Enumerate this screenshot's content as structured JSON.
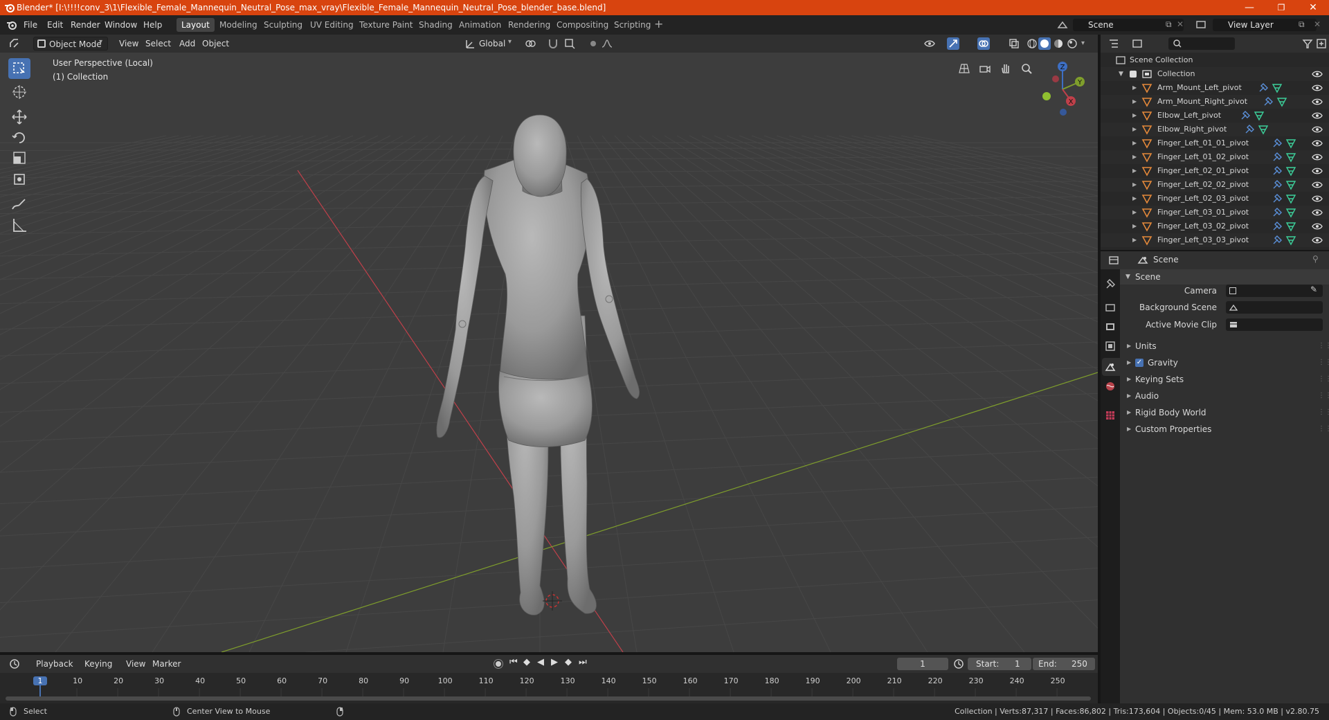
{
  "titlebar": {
    "title": "Blender* [I:\\!!!!conv_3\\1\\Flexible_Female_Mannequin_Neutral_Pose_max_vray\\Flexible_Female_Mannequin_Neutral_Pose_blender_base.blend]",
    "minimize": "—",
    "restore": "❐",
    "close": "✕"
  },
  "menus": [
    "File",
    "Edit",
    "Render",
    "Window",
    "Help"
  ],
  "workspaces": [
    "Layout",
    "Modeling",
    "Sculpting",
    "UV Editing",
    "Texture Paint",
    "Shading",
    "Animation",
    "Rendering",
    "Compositing",
    "Scripting"
  ],
  "active_workspace": "Layout",
  "scene_selector": "Scene",
  "view_layer_selector": "View Layer",
  "viewport_header": {
    "mode": "Object Mode",
    "menus": [
      "View",
      "Select",
      "Add",
      "Object"
    ],
    "orientation": "Global"
  },
  "viewport": {
    "perspective_label": "User Perspective (Local)",
    "collection_label": "(1) Collection",
    "gizmo": {
      "x": "X",
      "y": "Y",
      "z": "Z"
    }
  },
  "outliner": {
    "root": "Scene Collection",
    "collection": "Collection",
    "items": [
      "Arm_Mount_Left_pivot",
      "Arm_Mount_Right_pivot",
      "Elbow_Left_pivot",
      "Elbow_Right_pivot",
      "Finger_Left_01_01_pivot",
      "Finger_Left_01_02_pivot",
      "Finger_Left_02_01_pivot",
      "Finger_Left_02_02_pivot",
      "Finger_Left_02_03_pivot",
      "Finger_Left_03_01_pivot",
      "Finger_Left_03_02_pivot",
      "Finger_Left_03_03_pivot"
    ]
  },
  "properties": {
    "header": "Scene",
    "panel": "Scene",
    "camera_label": "Camera",
    "background_scene_label": "Background Scene",
    "active_movie_clip_label": "Active Movie Clip",
    "sections": [
      "Units",
      "Gravity",
      "Keying Sets",
      "Audio",
      "Rigid Body World",
      "Custom Properties"
    ],
    "gravity_checked": true
  },
  "timeline": {
    "menus": [
      "Playback",
      "Keying",
      "View",
      "Marker"
    ],
    "current_frame": "1",
    "start_label": "Start:",
    "start": "1",
    "end_label": "End:",
    "end": "250",
    "ticks": [
      "1",
      "10",
      "20",
      "30",
      "40",
      "50",
      "60",
      "70",
      "80",
      "90",
      "100",
      "110",
      "120",
      "130",
      "140",
      "150",
      "160",
      "170",
      "180",
      "190",
      "200",
      "210",
      "220",
      "230",
      "240",
      "250"
    ]
  },
  "statusbar": {
    "left": "Select",
    "middle": "Center View to Mouse",
    "stats": "Collection | Verts:87,317 | Faces:86,802 | Tris:173,604 | Objects:0/45 | Mem: 53.0 MB | v2.80.75"
  },
  "colors": {
    "titlebar": "#d8440f",
    "accent": "#4772b3",
    "x_axis": "#c0404a",
    "y_axis": "#7f9e2c",
    "object_icon": "#e5893a"
  }
}
